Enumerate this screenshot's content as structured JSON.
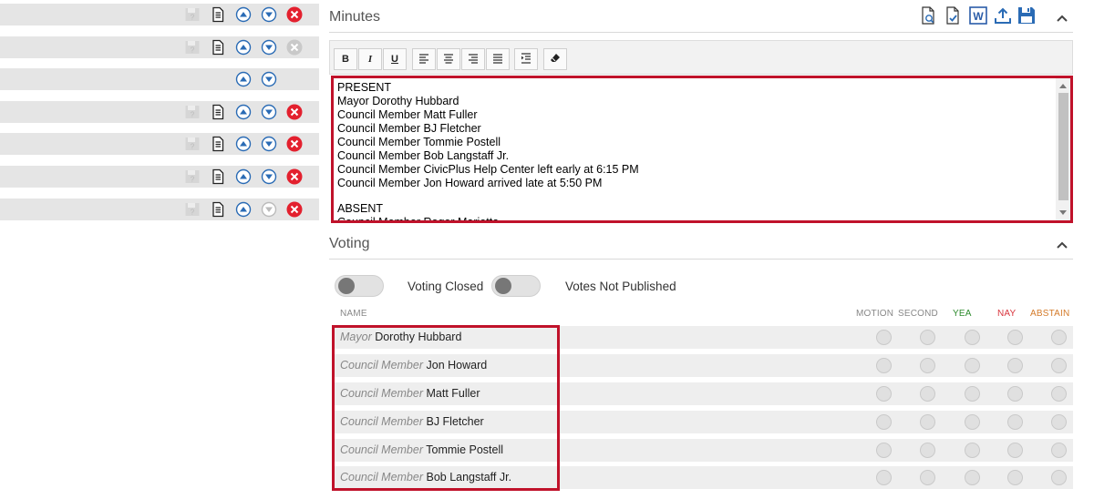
{
  "left_rows": [
    {
      "save": "disabled",
      "doc": "on",
      "up": "on",
      "down": "on",
      "del": "red"
    },
    {
      "save": "disabled",
      "doc": "on",
      "up": "on",
      "down": "on",
      "del": "gray"
    },
    {
      "save": "none",
      "doc": "none",
      "up": "on",
      "down": "on",
      "del": "none"
    },
    {
      "save": "disabled",
      "doc": "on",
      "up": "on",
      "down": "on",
      "del": "red"
    },
    {
      "save": "disabled",
      "doc": "on",
      "up": "on",
      "down": "on",
      "del": "red"
    },
    {
      "save": "disabled",
      "doc": "on",
      "up": "on",
      "down": "on",
      "del": "red"
    },
    {
      "save": "disabled",
      "doc": "on",
      "up": "on",
      "down": "disabled",
      "del": "red"
    }
  ],
  "minutes": {
    "title": "Minutes",
    "toolbar": {
      "bold": "B",
      "italic": "I",
      "underline": "U"
    },
    "top_icons": [
      "doc-preview-icon",
      "doc-check-icon",
      "word-icon",
      "upload-icon",
      "save-disk-icon"
    ],
    "lines_present": [
      "PRESENT",
      "Mayor Dorothy Hubbard",
      "Council Member Matt Fuller",
      "Council Member BJ Fletcher",
      "Council Member Tommie Postell",
      "Council Member Bob Langstaff Jr.",
      "Council Member CivicPlus Help Center left early at 6:15 PM",
      "Council Member Jon Howard arrived late at 5:50 PM"
    ],
    "lines_absent": [
      "ABSENT",
      "Council Member Roger Marietta"
    ]
  },
  "voting": {
    "title": "Voting",
    "toggle1_label": "Voting Closed",
    "toggle2_label": "Votes Not Published",
    "columns": {
      "name": "NAME",
      "motion": "MOTION",
      "second": "SECOND",
      "yea": "YEA",
      "nay": "NAY",
      "abstain": "ABSTAIN"
    },
    "colors": {
      "yea": "#2e8b2e",
      "nay": "#d9363e",
      "abstain": "#d47b2a",
      "highlight": "#c0122a"
    },
    "members": [
      {
        "title": "Mayor",
        "name": "Dorothy Hubbard"
      },
      {
        "title": "Council Member",
        "name": "Jon Howard"
      },
      {
        "title": "Council Member",
        "name": "Matt Fuller"
      },
      {
        "title": "Council Member",
        "name": "BJ Fletcher"
      },
      {
        "title": "Council Member",
        "name": "Tommie Postell"
      },
      {
        "title": "Council Member",
        "name": "Bob Langstaff Jr."
      }
    ]
  }
}
